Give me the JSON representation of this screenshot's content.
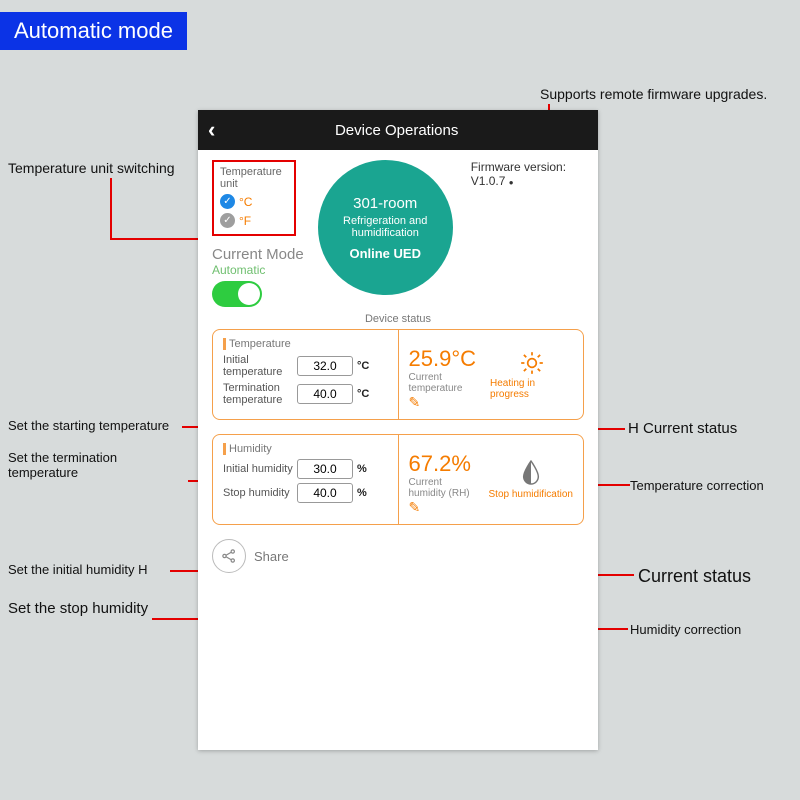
{
  "banner": "Automatic mode",
  "annotations": {
    "temp_unit_switching": "Temperature unit switching",
    "remote_fw": "Supports remote firmware upgrades.",
    "start_temp": "Set the starting temperature",
    "term_temp": "Set the termination temperature",
    "init_hum": "Set the initial humidity H",
    "stop_hum": "Set the stop humidity",
    "h_current_status": "H Current status",
    "temp_correction": "Temperature correction",
    "current_status": "Current status",
    "humidity_correction": "Humidity correction"
  },
  "header": {
    "title": "Device Operations"
  },
  "unit": {
    "label": "Temperature unit",
    "celsius": "°C",
    "fahrenheit": "°F",
    "selected": "C"
  },
  "mode": {
    "label": "Current Mode",
    "value": "Automatic",
    "on": true
  },
  "badge": {
    "room": "301-room",
    "line2": "Refrigeration and humidification",
    "status": "Online UED"
  },
  "firmware": {
    "label": "Firmware version:",
    "value": "V1.0.7"
  },
  "status_header": "Device status",
  "temp_card": {
    "section": "Temperature",
    "initial_label": "Initial temperature",
    "initial_value": "32.0",
    "term_label": "Termination temperature",
    "term_value": "40.0",
    "unit": "°C",
    "current_value": "25.9°C",
    "current_label": "Current temperature",
    "status": "Heating in progress"
  },
  "hum_card": {
    "section": "Humidity",
    "initial_label": "Initial humidity",
    "initial_value": "30.0",
    "stop_label": "Stop humidity",
    "stop_value": "40.0",
    "unit": "%",
    "current_value": "67.2%",
    "current_label": "Current humidity (RH)",
    "status": "Stop humidification"
  },
  "share": "Share"
}
